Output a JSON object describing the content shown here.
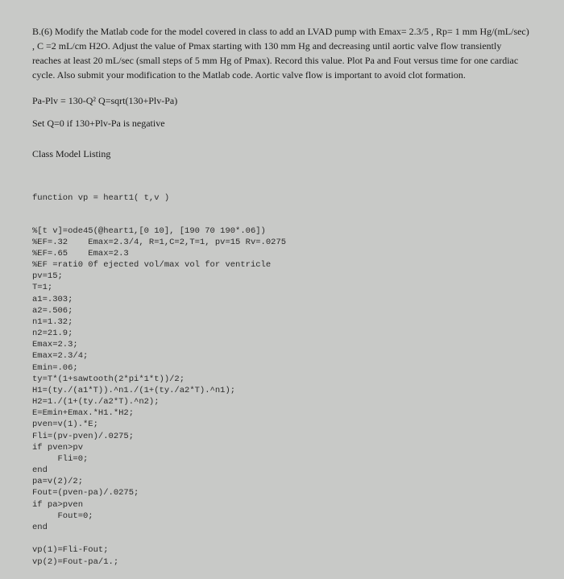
{
  "problem": {
    "text": "B.(6) Modify the Matlab code for the model covered in class to add an LVAD pump with Emax= 2.3/5 , Rp= 1 mm Hg/(mL/sec) , C =2 mL/cm H2O.   Adjust the value of Pmax starting with 130 mm Hg and decreasing until aortic valve flow transiently reaches at least 20 mL/sec (small steps of 5 mm Hg of Pmax). Record this value.  Plot Pa and Fout versus time for one cardiac cycle.  Also submit your modification to the Matlab code.  Aortic valve flow is important to avoid clot formation."
  },
  "equations": {
    "line1": "Pa-Plv = 130-Q²    Q=sqrt(130+Plv-Pa)",
    "line2": "Set Q=0  if 130+Plv-Pa  is negative"
  },
  "heading": "Class Model Listing",
  "code": {
    "func": "function vp = heart1( t,v )",
    "body": "%[t v]=ode45(@heart1,[0 10], [190 70 190*.06])\n%EF=.32    Emax=2.3/4, R=1,C=2,T=1, pv=15 Rv=.0275\n%EF=.65    Emax=2.3\n%EF =rati0 0f ejected vol/max vol for ventricle\npv=15;\nT=1;\na1=.303;\na2=.506;\nn1=1.32;\nn2=21.9;\nEmax=2.3;\nEmax=2.3/4;\nEmin=.06;\nty=T*(1+sawtooth(2*pi*1*t))/2;\nH1=(ty./(a1*T)).^n1./(1+(ty./a2*T).^n1);\nH2=1./(1+(ty./a2*T).^n2);\nE=Emin+Emax.*H1.*H2;\npven=v(1).*E;\nFli=(pv-pven)/.0275;\nif pven>pv\n     Fli=0;\nend\npa=v(2)/2;\nFout=(pven-pa)/.0275;\nif pa>pven\n     Fout=0;\nend\n\nvp(1)=Fli-Fout;\nvp(2)=Fout-pa/1.;"
  }
}
